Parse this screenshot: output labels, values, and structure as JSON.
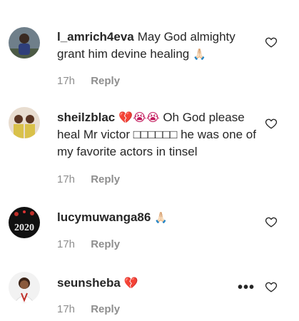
{
  "comments": [
    {
      "username": "l_amrich4eva",
      "text": "May God almighty grant him devine healing",
      "emoji": "🙏🏻",
      "time": "17h",
      "reply": "Reply"
    },
    {
      "username": "sheilzblac",
      "prefix_emoji": "💔😭😭",
      "text": "Oh God please heal Mr victor □□□□□□ he was one of my favorite actors in tinsel",
      "emoji": "",
      "time": "17h",
      "reply": "Reply"
    },
    {
      "username": "lucymuwanga86",
      "emoji": "🙏🏻",
      "text": "",
      "time": "17h",
      "reply": "Reply",
      "avatar_caption": "2020"
    },
    {
      "username": "seunsheba",
      "emoji": "💔",
      "text": "",
      "time": "17h",
      "reply": "Reply",
      "more": "•••"
    }
  ],
  "colors": {
    "text": "#262626",
    "muted": "#8e8e8e",
    "heart_outline": "#8e8e8e",
    "broken_heart": "#c2185b"
  },
  "icons": [
    "heart-outline-icon",
    "more-options-icon",
    "broken-heart-emoji",
    "praying-hands-emoji",
    "crying-face-emoji"
  ]
}
